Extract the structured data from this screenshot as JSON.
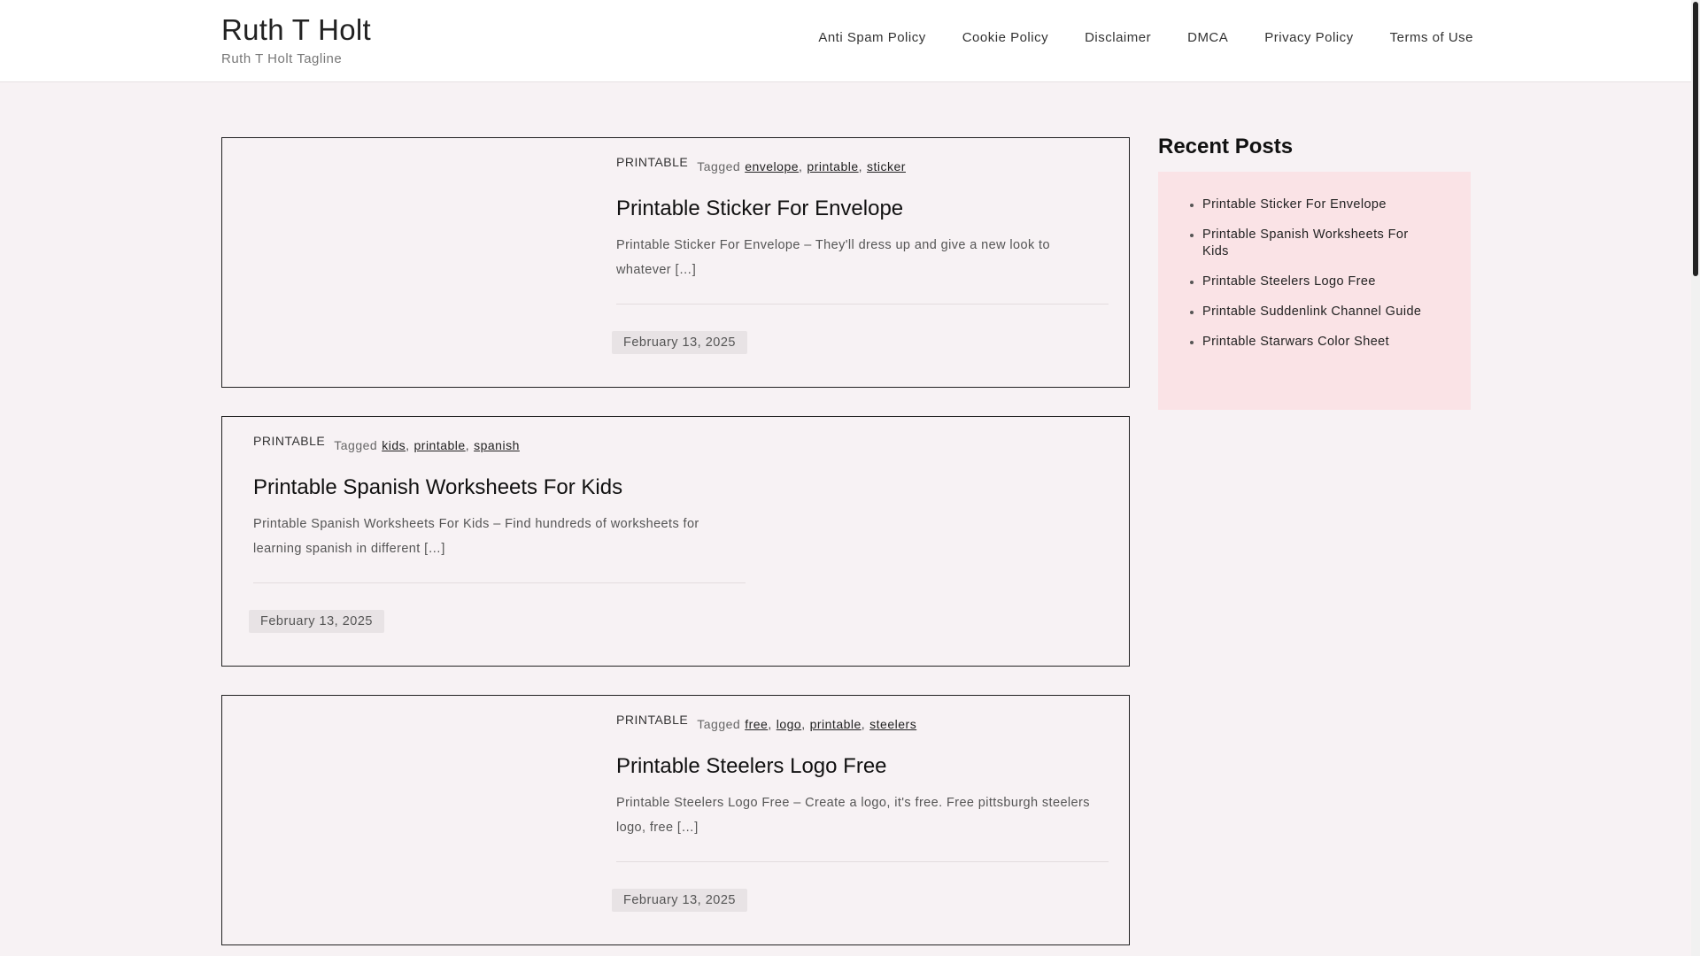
{
  "header": {
    "site_title": "Ruth T Holt",
    "tagline": "Ruth T Holt Tagline",
    "nav": [
      "Anti Spam Policy",
      "Cookie Policy",
      "Disclaimer",
      "DMCA",
      "Privacy Policy",
      "Terms of Use"
    ]
  },
  "posts": [
    {
      "category": "PRINTABLE",
      "tagged_label": "Tagged",
      "tags": [
        "envelope",
        "printable",
        "sticker"
      ],
      "title": "Printable Sticker For Envelope",
      "excerpt": "Printable Sticker For Envelope – They'll dress up and give a new look to whatever […]",
      "date": "February 13, 2025"
    },
    {
      "category": "PRINTABLE",
      "tagged_label": "Tagged",
      "tags": [
        "kids",
        "printable",
        "spanish"
      ],
      "title": "Printable Spanish Worksheets For Kids",
      "excerpt": "Printable Spanish Worksheets For Kids – Find hundreds of worksheets for learning spanish in different […]",
      "date": "February 13, 2025"
    },
    {
      "category": "PRINTABLE",
      "tagged_label": "Tagged",
      "tags": [
        "free",
        "logo",
        "printable",
        "steelers"
      ],
      "title": "Printable Steelers Logo Free",
      "excerpt": "Printable Steelers Logo Free – Create a logo, it's free. Free pittsburgh steelers logo, free […]",
      "date": "February 13, 2025"
    }
  ],
  "sidebar": {
    "recent_posts_title": "Recent Posts",
    "recent_posts": [
      "Printable Sticker For Envelope",
      "Printable Spanish Worksheets For Kids",
      "Printable Steelers Logo Free",
      "Printable Suddenlink Channel Guide",
      "Printable Starwars Color Sheet"
    ]
  },
  "colors": {
    "background": "#f7f2f4",
    "widget_background": "#fae3e6",
    "date_badge": "#e8e3e5"
  }
}
